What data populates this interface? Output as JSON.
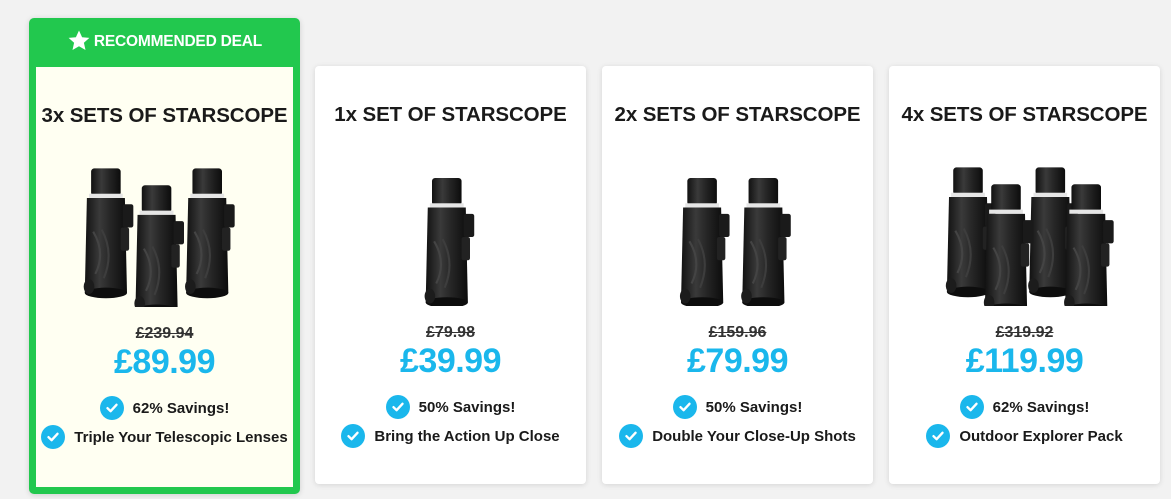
{
  "colors": {
    "featured_green": "#22c84e",
    "price_blue": "#1ab7ec",
    "featured_background": "#fffff2"
  },
  "banner": {
    "label": "RECOMMENDED DEAL",
    "icon": "star-icon"
  },
  "deals": [
    {
      "title": "3x SETS OF STARSCOPE",
      "old_price": "£239.94",
      "new_price": "£89.99",
      "savings": "62% Savings!",
      "feature": "Triple Your Telescopic Lenses",
      "featured": true,
      "image": "three-monoculars"
    },
    {
      "title": "1x SET OF STARSCOPE",
      "old_price": "£79.98",
      "new_price": "£39.99",
      "savings": "50% Savings!",
      "feature": "Bring the Action Up Close",
      "featured": false,
      "image": "one-monocular"
    },
    {
      "title": "2x SETS OF STARSCOPE",
      "old_price": "£159.96",
      "new_price": "£79.99",
      "savings": "50% Savings!",
      "feature": "Double Your Close-Up Shots",
      "featured": false,
      "image": "two-monoculars"
    },
    {
      "title": "4x SETS OF STARSCOPE",
      "old_price": "£319.92",
      "new_price": "£119.99",
      "savings": "62% Savings!",
      "feature": "Outdoor Explorer Pack",
      "featured": false,
      "image": "four-monoculars"
    }
  ]
}
